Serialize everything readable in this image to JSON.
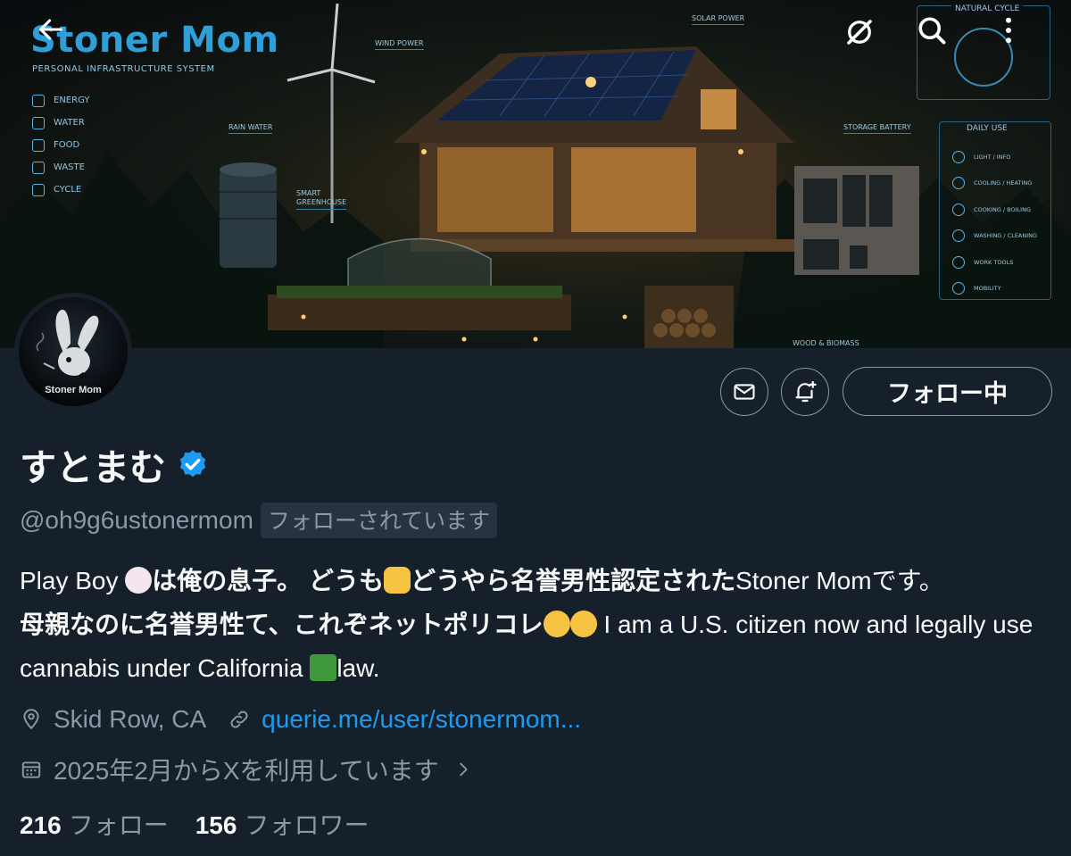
{
  "banner": {
    "title": "Stoner Mom",
    "subtitle": "PERSONAL INFRASTRUCTURE SYSTEM",
    "legend": [
      "ENERGY",
      "WATER",
      "FOOD",
      "WASTE",
      "CYCLE"
    ],
    "callouts": {
      "wind": "WIND POWER",
      "solar": "SOLAR POWER",
      "rain": "RAIN WATER",
      "greenhouse": "SMART GREENHOUSE",
      "battery": "STORAGE BATTERY",
      "wood": "WOOD & BIOMASS"
    },
    "cycle_title": "NATURAL CYCLE",
    "daily_title": "DAILY USE",
    "daily_items": [
      "LIGHT / INFO",
      "COOLING / HEATING",
      "COOKING / BOILING",
      "WASHING / CLEANING",
      "WORK TOOLS",
      "MOBILITY"
    ]
  },
  "avatar": {
    "label": "Stoner Mom"
  },
  "actions": {
    "follow_label": "フォロー中"
  },
  "profile": {
    "display_name": "すとまむ",
    "handle": "@oh9g6ustonermom",
    "follows_you": "フォローされています",
    "bio": {
      "p1": "Play Boy ",
      "p2": "は俺の息子。 どうも",
      "p3": "どうやら名誉男性認定された",
      "p4": "Stoner Momです。",
      "p5": "母親なのに名誉男性て、これぞネットポリコレ",
      "p6": " I am a U.S. citizen now and legally use cannabis under California ",
      "p7": "law."
    },
    "location": "Skid Row, CA",
    "website": "querie.me/user/stonermom...",
    "joined": "2025年2月からXを利用しています"
  },
  "stats": {
    "following_count": "216",
    "following_label": "フォロー",
    "followers_count": "156",
    "followers_label": "フォロワー"
  },
  "icons": {
    "back": "back-arrow-icon",
    "grok": "grok-icon",
    "search": "search-icon",
    "more": "more-vertical-icon",
    "message": "envelope-icon",
    "notify": "bell-plus-icon",
    "verified": "verified-badge-icon",
    "location": "location-pin-icon",
    "link": "link-icon",
    "calendar": "calendar-icon",
    "chevron": "chevron-right-icon"
  },
  "colors": {
    "background": "#15202b",
    "accent": "#1d9bf0",
    "muted": "#8b98a5",
    "text": "#f7f9f9"
  }
}
